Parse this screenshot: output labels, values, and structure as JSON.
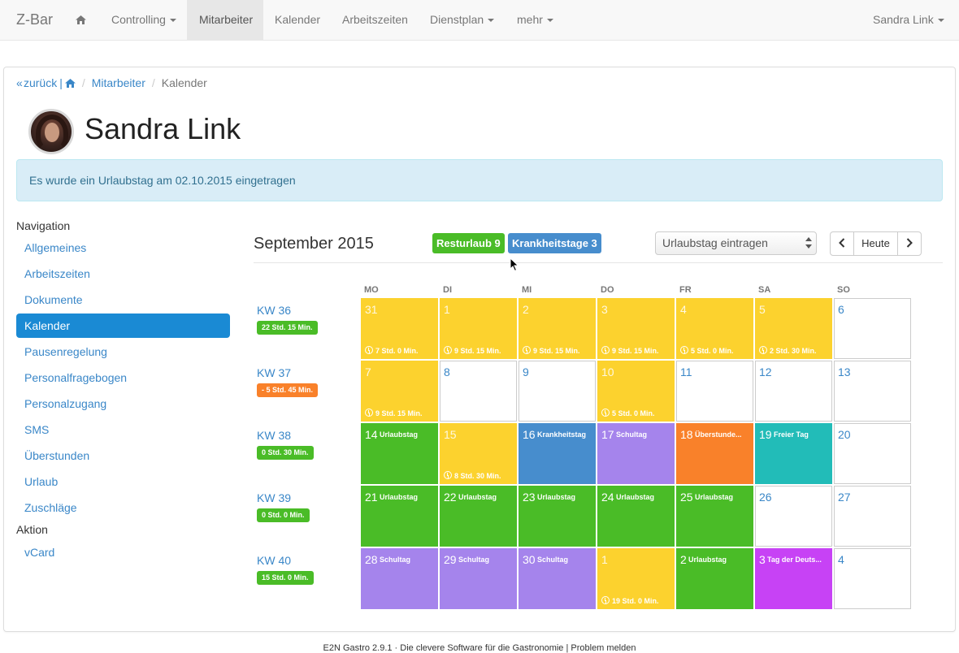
{
  "colors": {
    "urlaub": "#4abc27",
    "arbeit": "#fcd22e",
    "krank": "#478dcd",
    "schule": "#a584ec",
    "ueberstunden": "#f9812a",
    "frei": "#22bcb8",
    "feiertag": "#c742f5",
    "leer": "#ffffff"
  },
  "navbar": {
    "brand": "Z-Bar",
    "home_icon": "home-icon",
    "items": [
      "Controlling",
      "Mitarbeiter",
      "Kalender",
      "Arbeitszeiten",
      "Dienstplan",
      "mehr"
    ],
    "user": "Sandra Link"
  },
  "breadcrumb": {
    "back": "zurück",
    "home_icon": "home-icon",
    "section": "Mitarbeiter",
    "current": "Kalender"
  },
  "profile": {
    "name": "Sandra Link"
  },
  "alert": {
    "text": "Es wurde ein Urlaubstag am 02.10.2015 eingetragen"
  },
  "sidebar": {
    "nav_heading": "Navigation",
    "items": [
      "Allgemeines",
      "Arbeitszeiten",
      "Dokumente",
      "Kalender",
      "Pausenregelung",
      "Personalfragebogen",
      "Personalzugang",
      "SMS",
      "Überstunden",
      "Urlaub",
      "Zuschläge"
    ],
    "active": "Kalender",
    "action_heading": "Aktion",
    "action_items": [
      "vCard"
    ]
  },
  "calendar": {
    "month": "September 2015",
    "resturlaub": "Resturlaub 9",
    "krankheitstage": "Krankheitstage 3",
    "select_value": "Urlaubstag eintragen",
    "today_button": "Heute",
    "prev_icon": "chevron-left-icon",
    "next_icon": "chevron-right-icon",
    "weekdays": [
      "MO",
      "DI",
      "MI",
      "DO",
      "FR",
      "SA",
      "SO"
    ],
    "weeks": [
      {
        "kw": "KW 36",
        "badge": "22 Std. 15 Min.",
        "badge_type": "urlaub",
        "days": [
          {
            "n": "31",
            "type": "arbeit",
            "dur": "7 Std. 0 Min."
          },
          {
            "n": "1",
            "type": "arbeit",
            "dur": "9 Std. 15 Min."
          },
          {
            "n": "2",
            "type": "arbeit",
            "dur": "9 Std. 15 Min."
          },
          {
            "n": "3",
            "type": "arbeit",
            "dur": "9 Std. 15 Min."
          },
          {
            "n": "4",
            "type": "arbeit",
            "dur": "5 Std. 0 Min."
          },
          {
            "n": "5",
            "type": "arbeit",
            "dur": "2 Std. 30 Min."
          },
          {
            "n": "6",
            "type": "leer"
          }
        ]
      },
      {
        "kw": "KW 37",
        "badge": "- 5 Std. 45 Min.",
        "badge_type": "ueberstunden",
        "days": [
          {
            "n": "7",
            "type": "arbeit",
            "dur": "9 Std. 15 Min."
          },
          {
            "n": "8",
            "type": "leer"
          },
          {
            "n": "9",
            "type": "leer"
          },
          {
            "n": "10",
            "type": "arbeit",
            "dur": "5 Std. 0 Min."
          },
          {
            "n": "11",
            "type": "leer"
          },
          {
            "n": "12",
            "type": "leer"
          },
          {
            "n": "13",
            "type": "leer"
          }
        ]
      },
      {
        "kw": "KW 38",
        "badge": "0 Std. 30 Min.",
        "badge_type": "urlaub",
        "days": [
          {
            "n": "14",
            "type": "urlaub",
            "label": "Urlaubstag"
          },
          {
            "n": "15",
            "type": "arbeit",
            "dur": "8 Std. 30 Min."
          },
          {
            "n": "16",
            "type": "krank",
            "label": "Krankheitstag"
          },
          {
            "n": "17",
            "type": "schule",
            "label": "Schultag"
          },
          {
            "n": "18",
            "type": "ueberstunden",
            "label": "Überstunde..."
          },
          {
            "n": "19",
            "type": "frei",
            "label": "Freier Tag"
          },
          {
            "n": "20",
            "type": "leer"
          }
        ]
      },
      {
        "kw": "KW 39",
        "badge": "0 Std. 0 Min.",
        "badge_type": "urlaub",
        "days": [
          {
            "n": "21",
            "type": "urlaub",
            "label": "Urlaubstag"
          },
          {
            "n": "22",
            "type": "urlaub",
            "label": "Urlaubstag"
          },
          {
            "n": "23",
            "type": "urlaub",
            "label": "Urlaubstag"
          },
          {
            "n": "24",
            "type": "urlaub",
            "label": "Urlaubstag"
          },
          {
            "n": "25",
            "type": "urlaub",
            "label": "Urlaubstag"
          },
          {
            "n": "26",
            "type": "leer"
          },
          {
            "n": "27",
            "type": "leer"
          }
        ]
      },
      {
        "kw": "KW 40",
        "badge": "15 Std. 0 Min.",
        "badge_type": "urlaub",
        "days": [
          {
            "n": "28",
            "type": "schule",
            "label": "Schultag"
          },
          {
            "n": "29",
            "type": "schule",
            "label": "Schultag"
          },
          {
            "n": "30",
            "type": "schule",
            "label": "Schultag"
          },
          {
            "n": "1",
            "type": "arbeit",
            "dur": "19 Std. 0 Min."
          },
          {
            "n": "2",
            "type": "urlaub",
            "label": "Urlaubstag"
          },
          {
            "n": "3",
            "type": "feiertag",
            "label": "Tag der Deuts..."
          },
          {
            "n": "4",
            "type": "leer"
          }
        ]
      }
    ]
  },
  "footer": {
    "text": "E2N Gastro 2.9.1 · Die clevere Software für die Gastronomie | Problem melden"
  }
}
